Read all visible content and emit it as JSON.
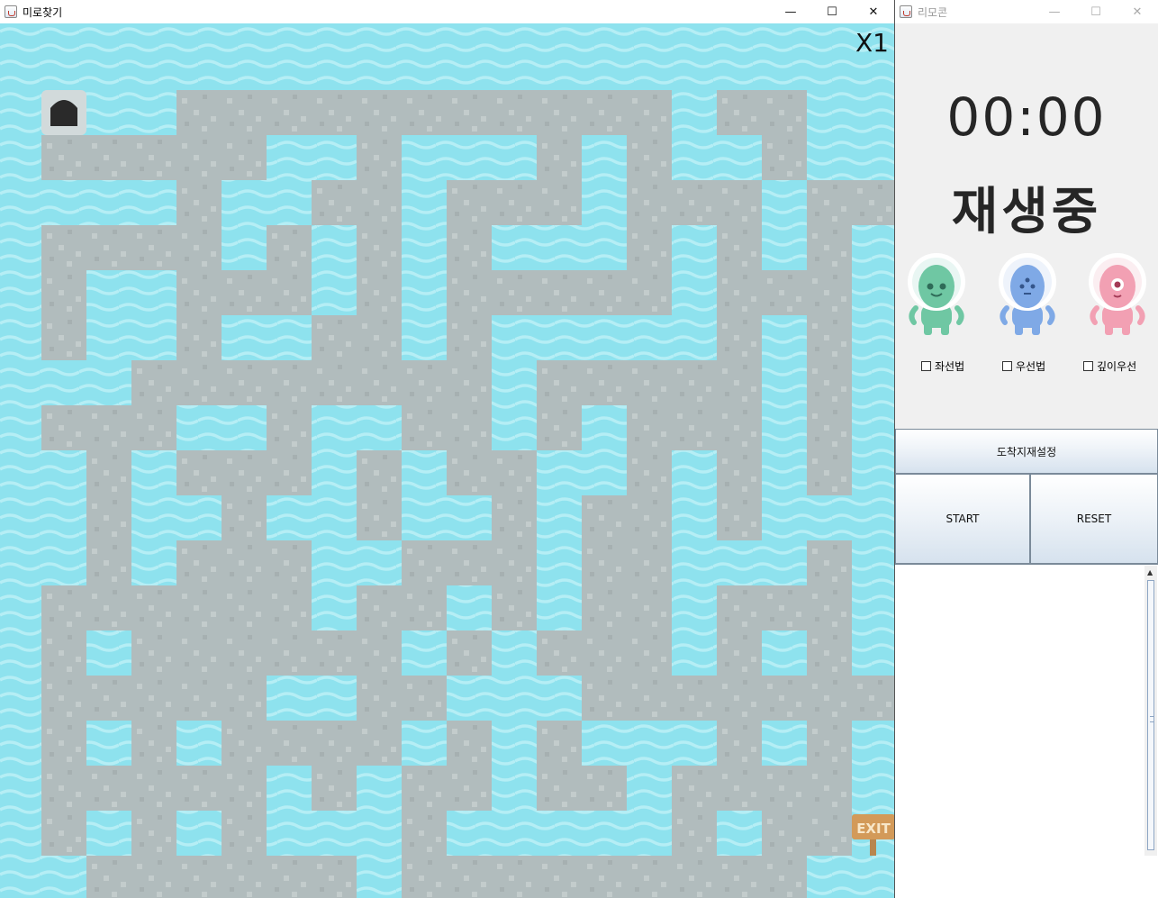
{
  "maze_window": {
    "title": "미로찾기",
    "controls": {
      "minimize": "—",
      "maximize": "☐",
      "close": "✕"
    },
    "speed_label": "X1",
    "exit_sign": "EXIT",
    "colors": {
      "water": "#8ee2ee",
      "wave": "#b5eef5",
      "path": "#b1bcbd",
      "pebble": "#c3cccc"
    }
  },
  "remote_window": {
    "title": "리모콘",
    "controls": {
      "minimize": "—",
      "maximize": "☐",
      "close": "✕"
    },
    "timer": "00:00",
    "status": "재생중",
    "aliens": [
      {
        "icon": "green-alien-icon",
        "color": "#6fc7a3"
      },
      {
        "icon": "blue-alien-icon",
        "color": "#7fa9e6"
      },
      {
        "icon": "pink-alien-icon",
        "color": "#f2a0b3"
      }
    ],
    "algorithms": [
      "좌선법",
      "우선법",
      "깊이우선"
    ],
    "buttons": {
      "set_destination": "도착지재설정",
      "start": "START",
      "reset": "RESET"
    }
  }
}
